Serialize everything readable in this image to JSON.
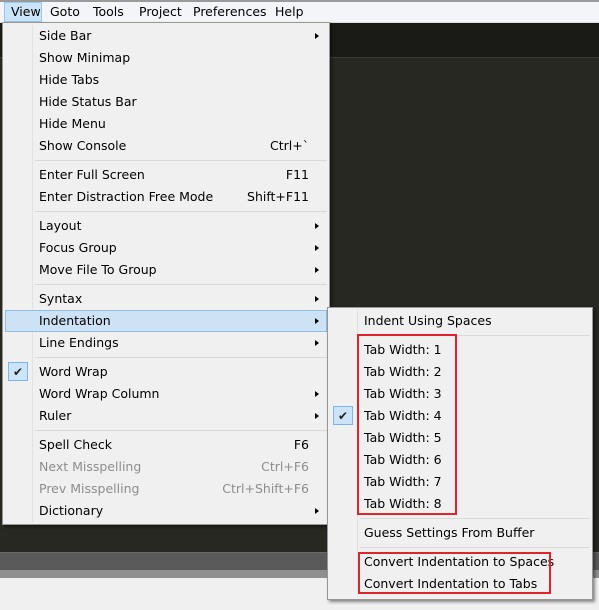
{
  "menubar": {
    "items": [
      {
        "label": "View",
        "active": true
      },
      {
        "label": "Goto"
      },
      {
        "label": "Tools"
      },
      {
        "label": "Project"
      },
      {
        "label": "Preferences"
      },
      {
        "label": "Help"
      }
    ]
  },
  "view_menu": {
    "items": [
      {
        "label": "Side Bar",
        "submenu": true
      },
      {
        "label": "Show Minimap"
      },
      {
        "label": "Hide Tabs"
      },
      {
        "label": "Hide Status Bar"
      },
      {
        "label": "Hide Menu"
      },
      {
        "label": "Show Console",
        "shortcut": "Ctrl+`"
      },
      {
        "label": "Enter Full Screen",
        "shortcut": "F11"
      },
      {
        "label": "Enter Distraction Free Mode",
        "shortcut": "Shift+F11"
      },
      {
        "label": "Layout",
        "submenu": true
      },
      {
        "label": "Focus Group",
        "submenu": true
      },
      {
        "label": "Move File To Group",
        "submenu": true
      },
      {
        "label": "Syntax",
        "submenu": true
      },
      {
        "label": "Indentation",
        "submenu": true,
        "highlighted": true
      },
      {
        "label": "Line Endings",
        "submenu": true
      },
      {
        "label": "Word Wrap",
        "checked": true
      },
      {
        "label": "Word Wrap Column",
        "submenu": true
      },
      {
        "label": "Ruler",
        "submenu": true
      },
      {
        "label": "Spell Check",
        "shortcut": "F6"
      },
      {
        "label": "Next Misspelling",
        "shortcut": "Ctrl+F6",
        "disabled": true
      },
      {
        "label": "Prev Misspelling",
        "shortcut": "Ctrl+Shift+F6",
        "disabled": true
      },
      {
        "label": "Dictionary",
        "submenu": true
      }
    ]
  },
  "indentation_menu": {
    "items": [
      {
        "label": "Indent Using Spaces"
      },
      {
        "label": "Tab Width: 1"
      },
      {
        "label": "Tab Width: 2"
      },
      {
        "label": "Tab Width: 3"
      },
      {
        "label": "Tab Width: 4",
        "checked": true
      },
      {
        "label": "Tab Width: 5"
      },
      {
        "label": "Tab Width: 6"
      },
      {
        "label": "Tab Width: 7"
      },
      {
        "label": "Tab Width: 8"
      },
      {
        "label": "Guess Settings From Buffer"
      },
      {
        "label": "Convert Indentation to Spaces"
      },
      {
        "label": "Convert Indentation to Tabs"
      }
    ]
  },
  "icons": {
    "check": "✔"
  },
  "annotation_color": "#e0242b"
}
